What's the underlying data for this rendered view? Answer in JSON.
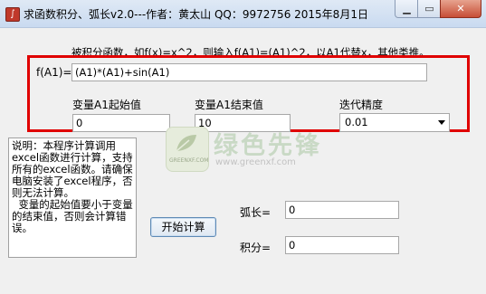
{
  "window": {
    "title": "求函数积分、弧长v2.0---作者：黄太山 QQ：9972756  2015年8月1日",
    "icon": "app-function-icon",
    "controls": {
      "minimize": "minimize-icon",
      "maximize": "maximize-icon",
      "close": "close-icon"
    }
  },
  "hint": "被积分函数，如f(x)=x^2，则输入f(A1)=(A1)^2，以A1代替x，其他类推。",
  "function": {
    "label": "f(A1)=",
    "value": "(A1)*(A1)+sin(A1)"
  },
  "start": {
    "label": "变量A1起始值",
    "value": "0"
  },
  "end": {
    "label": "变量A1结束值",
    "value": "10"
  },
  "precision": {
    "label": "迭代精度",
    "selected": "0.01"
  },
  "note": "说明：本程序计算调用excel函数进行计算，支持所有的excel函数。请确保电脑安装了excel程序，否则无法计算。\n  变量的起始值要小于变量的结束值，否则会计算错误。",
  "compute_button": "开始计算",
  "arc_length": {
    "label": "弧长=",
    "value": "0"
  },
  "integral": {
    "label": "积分=",
    "value": "0"
  },
  "watermark": {
    "title": "绿色先锋",
    "url": "www.greenxf.com",
    "logo_text": "GREENXF.COM"
  },
  "colors": {
    "highlight_frame": "#e00000",
    "window_bg": "#f0f0f0",
    "watermark_green": "#c9d9c5"
  }
}
